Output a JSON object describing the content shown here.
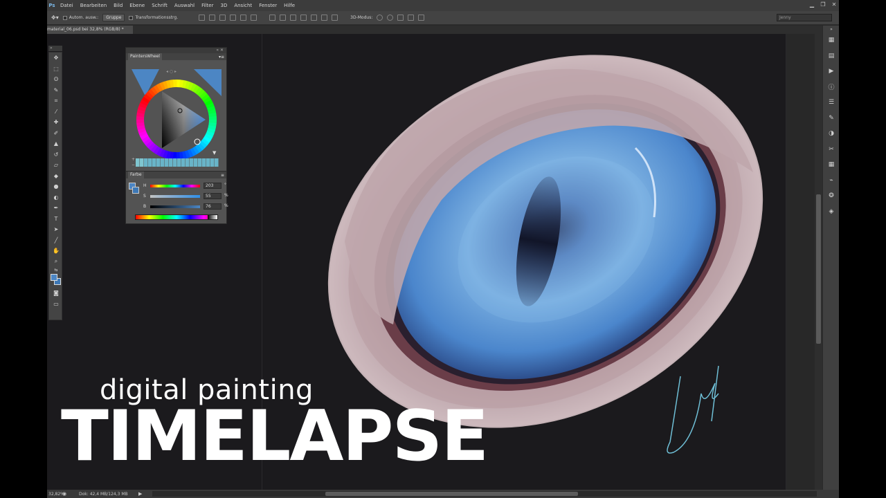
{
  "app": {
    "logo": "Ps"
  },
  "menu": [
    "Datei",
    "Bearbeiten",
    "Bild",
    "Ebene",
    "Schrift",
    "Auswahl",
    "Filter",
    "3D",
    "Ansicht",
    "Fenster",
    "Hilfe"
  ],
  "options": {
    "auto_select_label": "Autom. ausw.:",
    "auto_select_value": "Gruppe",
    "transform_label": "Transformationsstrg.",
    "mode_3d_label": "3D-Modus:",
    "workspace": "Jenny"
  },
  "document": {
    "tab_title": "material_06.psd bei 32,8% (RGB/8) *"
  },
  "painters_wheel": {
    "tab_label": "PaintersWheel",
    "current_color": "#4c86c4"
  },
  "color_panel": {
    "tab_label": "Farbe",
    "h_label": "H",
    "h_value": "203",
    "h_unit": "°",
    "s_label": "S",
    "s_value": "55",
    "s_unit": "%",
    "b_label": "B",
    "b_value": "76",
    "b_unit": "%"
  },
  "status": {
    "zoom": "32,82%",
    "doc_info": "Dok: 42,4 MB/124,3 MB"
  },
  "overlay": {
    "subtitle": "digital painting",
    "title": "TIMELAPSE"
  },
  "colors": {
    "accent": "#4c86c4",
    "canvas_bg": "#1b1a1d",
    "iris": "#5aa0e0"
  },
  "icons": {
    "tools": [
      "move-icon",
      "marquee-icon",
      "lasso-icon",
      "quick-select-icon",
      "crop-icon",
      "eyedropper-icon",
      "healing-icon",
      "brush-icon",
      "stamp-icon",
      "history-brush-icon",
      "eraser-icon",
      "bucket-icon",
      "blur-icon",
      "dodge-icon",
      "pen-icon",
      "type-icon",
      "path-select-icon",
      "line-icon",
      "hand-icon",
      "zoom-icon"
    ]
  }
}
